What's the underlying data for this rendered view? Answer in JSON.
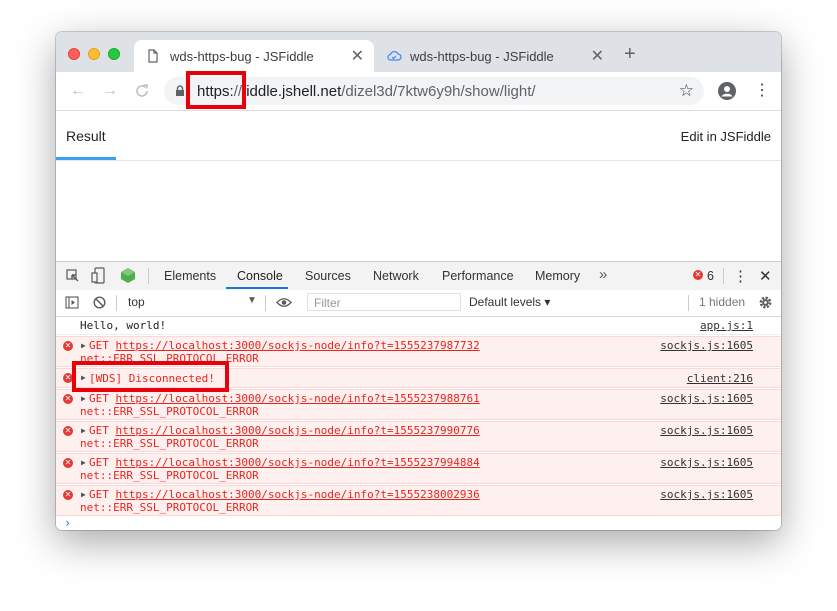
{
  "browser": {
    "tabs": [
      {
        "title": "wds-https-bug - JSFiddle",
        "icon": "document-icon",
        "active": true
      },
      {
        "title": "wds-https-bug - JSFiddle",
        "icon": "cloud-icon",
        "active": false
      }
    ],
    "close_glyph": "✕",
    "new_tab_glyph": "+",
    "url_scheme": "https:",
    "url_slashes": "//",
    "url_host": "fiddle.jshell.net",
    "url_path": "/dizel3d/7ktw6y9h/show/light/",
    "star_glyph": "☆"
  },
  "page": {
    "result_tab": "Result",
    "edit_link": "Edit in JSFiddle"
  },
  "devtools": {
    "tabs": [
      "Elements",
      "Console",
      "Sources",
      "Network",
      "Performance",
      "Memory"
    ],
    "active_tab": "Console",
    "overflow_glyph": "»",
    "error_count": "6",
    "context": "top",
    "filter_placeholder": "Filter",
    "levels": "Default levels ▾",
    "hidden": "1 hidden"
  },
  "console": {
    "messages": [
      {
        "type": "info",
        "text": "Hello, world!",
        "source": "app.js:1"
      },
      {
        "type": "error",
        "method": "GET",
        "url": "https://localhost:3000/sockjs-node/info?t=1555237987732",
        "detail": "net::ERR_SSL_PROTOCOL_ERROR",
        "source": "sockjs.js:1605"
      },
      {
        "type": "error",
        "text": "[WDS] Disconnected!",
        "source": "client:216"
      },
      {
        "type": "error",
        "method": "GET",
        "url": "https://localhost:3000/sockjs-node/info?t=1555237988761",
        "detail": "net::ERR_SSL_PROTOCOL_ERROR",
        "source": "sockjs.js:1605"
      },
      {
        "type": "error",
        "method": "GET",
        "url": "https://localhost:3000/sockjs-node/info?t=1555237990776",
        "detail": "net::ERR_SSL_PROTOCOL_ERROR",
        "source": "sockjs.js:1605"
      },
      {
        "type": "error",
        "method": "GET",
        "url": "https://localhost:3000/sockjs-node/info?t=1555237994884",
        "detail": "net::ERR_SSL_PROTOCOL_ERROR",
        "source": "sockjs.js:1605"
      },
      {
        "type": "error",
        "method": "GET",
        "url": "https://localhost:3000/sockjs-node/info?t=1555238002936",
        "detail": "net::ERR_SSL_PROTOCOL_ERROR",
        "source": "sockjs.js:1605"
      }
    ],
    "prompt_glyph": "›"
  },
  "colors": {
    "error_text": "#e8251d",
    "error_bg": "#fff0f0",
    "highlight": "#e8000b",
    "active_tab_underline": "#1a73e8"
  }
}
